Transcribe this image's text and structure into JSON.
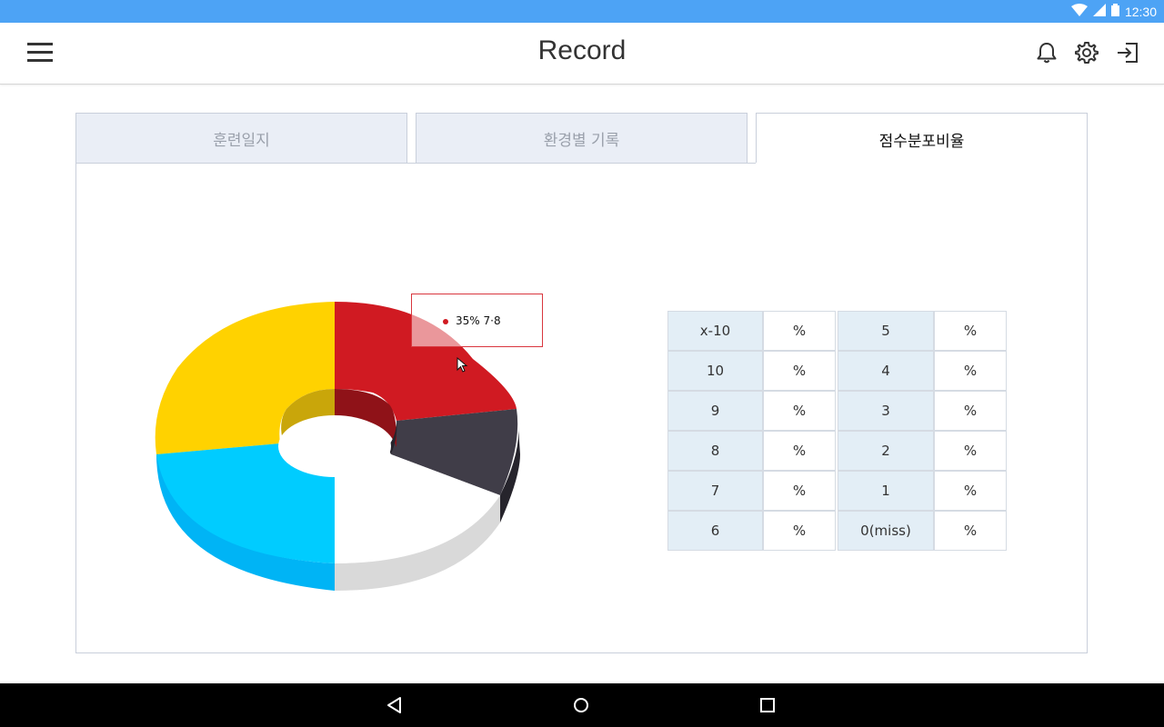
{
  "status_bar": {
    "time": "12:30"
  },
  "app_bar": {
    "title": "Record",
    "icons": [
      "menu-icon",
      "bell-icon",
      "gear-icon",
      "logout-icon"
    ]
  },
  "tabs": [
    {
      "label": "훈련일지",
      "active": false
    },
    {
      "label": "환경별 기록",
      "active": false
    },
    {
      "label": "점수분포비율",
      "active": true
    }
  ],
  "chart_data": {
    "type": "pie",
    "style": "3d-donut",
    "title": "",
    "slices": [
      {
        "label": "7·8",
        "value": 35,
        "color": "#d01a22"
      },
      {
        "label": "",
        "value": 10,
        "color": "#403d48"
      },
      {
        "label": "",
        "value": 15,
        "color": "#ffffff"
      },
      {
        "label": "",
        "value": 20,
        "color": "#00ccff"
      },
      {
        "label": "",
        "value": 20,
        "color": "#ffd200"
      }
    ],
    "tooltip": {
      "value": "35%",
      "label": "7·8"
    }
  },
  "score_table": {
    "rows": [
      {
        "left_label": "x-10",
        "left_value": "%",
        "right_label": "5",
        "right_value": "%"
      },
      {
        "left_label": "10",
        "left_value": "%",
        "right_label": "4",
        "right_value": "%"
      },
      {
        "left_label": "9",
        "left_value": "%",
        "right_label": "3",
        "right_value": "%"
      },
      {
        "left_label": "8",
        "left_value": "%",
        "right_label": "2",
        "right_value": "%"
      },
      {
        "left_label": "7",
        "left_value": "%",
        "right_label": "1",
        "right_value": "%"
      },
      {
        "left_label": "6",
        "left_value": "%",
        "right_label": "0(miss)",
        "right_value": "%"
      }
    ]
  },
  "nav_bar": {
    "icons": [
      "back-icon",
      "home-icon",
      "recents-icon"
    ]
  }
}
